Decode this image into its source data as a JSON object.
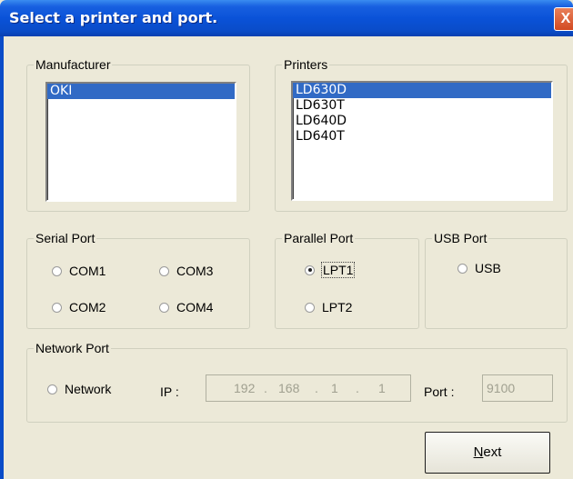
{
  "window": {
    "title": "Select a printer and port.",
    "close_glyph": "X"
  },
  "manufacturer": {
    "legend": "Manufacturer",
    "items": [
      "OKI"
    ],
    "selected": 0
  },
  "printers": {
    "legend": "Printers",
    "items": [
      "LD630D",
      "LD630T",
      "LD640D",
      "LD640T"
    ],
    "selected": 0
  },
  "serial_port": {
    "legend": "Serial Port",
    "options": [
      "COM1",
      "COM3",
      "COM2",
      "COM4"
    ]
  },
  "parallel_port": {
    "legend": "Parallel Port",
    "options": [
      "LPT1",
      "LPT2"
    ],
    "selected": "LPT1"
  },
  "usb_port": {
    "legend": "USB Port",
    "options": [
      "USB"
    ]
  },
  "network_port": {
    "legend": "Network Port",
    "option": "Network",
    "ip_label": "IP :",
    "ip_octets": [
      "192",
      "168",
      "1",
      "1"
    ],
    "ip_separator": ".",
    "port_label": "Port :",
    "port_value": "9100"
  },
  "buttons": {
    "next_prefix": "N",
    "next_rest": "ext"
  }
}
